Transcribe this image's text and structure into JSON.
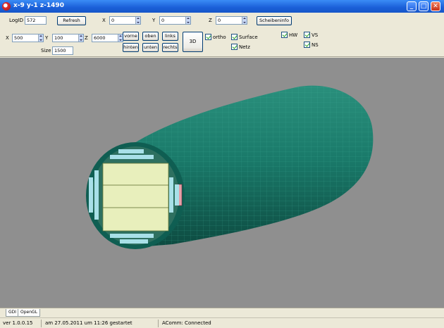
{
  "window": {
    "title": "x-9 y-1 z-1490"
  },
  "toolbar": {
    "logid_label": "LogID",
    "logid_value": "572",
    "refresh_label": "Refresh",
    "x1_label": "X",
    "x1_value": "0",
    "y1_label": "Y",
    "y1_value": "0",
    "z1_label": "Z",
    "z1_value": "0",
    "scheibeninfo_label": "Scheibeninfo",
    "x2_label": "X",
    "x2_value": "500",
    "y2_label": "Y",
    "y2_value": "100",
    "z2_label": "Z",
    "z2_value": "6000",
    "size_label": "Size",
    "size_value": "1500",
    "vorne_label": "vorne",
    "hinten_label": "hinten",
    "oben_label": "oben",
    "unten_label": "unten",
    "links_label": "links",
    "rechts_label": "rechts",
    "btn3d_label": "3D",
    "ortho_label": "ortho",
    "surface_label": "Surface",
    "netz_label": "Netz",
    "hw_label": "HW",
    "vs_label": "VS",
    "ns_label": "NS"
  },
  "tabs": [
    {
      "label": "GDI"
    },
    {
      "label": "OpenGL"
    }
  ],
  "status": {
    "version": "ver 1.0.0.15",
    "started": "am 27.05.2011 um 11:26 gestartet",
    "comm": "AComm: Connected"
  },
  "colors": {
    "tunnel": "#1a7a6a",
    "tunnel_dark": "#0d4a40",
    "face_fill": "#e8efbc",
    "block_blue": "#a8e0e8",
    "block_pink": "#e7a0a8",
    "viewport_bg": "#8f8f8f"
  }
}
